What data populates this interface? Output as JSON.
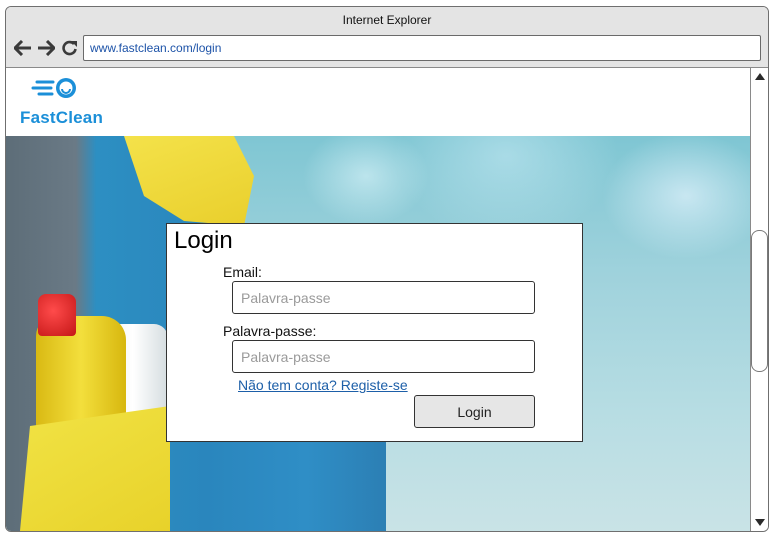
{
  "browser": {
    "title": "Internet Explorer",
    "url": "www.fastclean.com/login",
    "nav": {
      "back_icon": "arrow-left-icon",
      "forward_icon": "arrow-right-icon",
      "reload_icon": "reload-icon"
    }
  },
  "site": {
    "logo_text": "FastClean",
    "brand_color": "#1b8fd8"
  },
  "login": {
    "title": "Login",
    "email_label": "Email:",
    "email_placeholder": "Palavra-passe",
    "password_label": "Palavra-passe:",
    "password_placeholder": "Palavra-passe",
    "register_link": "Não tem conta? Registe-se",
    "submit_label": "Login"
  },
  "colors": {
    "link": "#1d5fa8",
    "url_text": "#1d53a8"
  }
}
